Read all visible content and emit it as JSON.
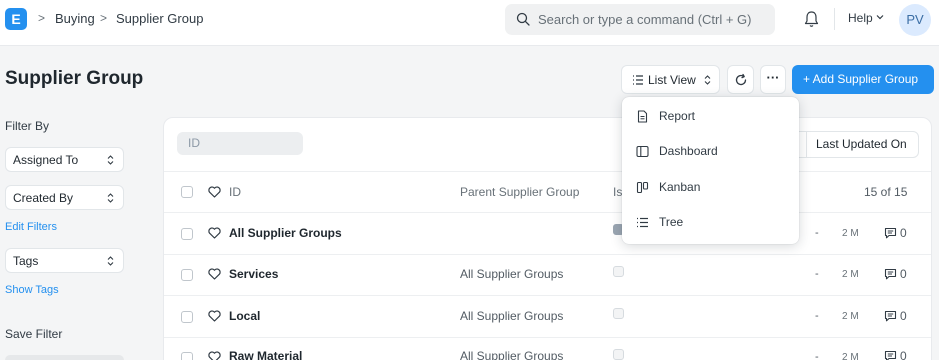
{
  "navbar": {
    "logo_letter": "E",
    "breadcrumbs": [
      "Buying",
      "Supplier Group"
    ],
    "search_placeholder": "Search or type a command (Ctrl + G)",
    "help_label": "Help",
    "avatar_initials": "PV"
  },
  "page": {
    "title": "Supplier Group",
    "list_view_label": "List View",
    "more_label": "···",
    "add_button_label": "+ Add Supplier Group"
  },
  "sidebar": {
    "filter_by_label": "Filter By",
    "assigned_to_label": "Assigned To",
    "created_by_label": "Created By",
    "edit_filters_label": "Edit Filters",
    "tags_label": "Tags",
    "show_tags_label": "Show Tags",
    "save_filter_label": "Save Filter"
  },
  "list": {
    "id_filter_placeholder": "ID",
    "sort_label": "Last Updated On",
    "columns": {
      "id": "ID",
      "parent": "Parent Supplier Group",
      "is_group": "Is"
    },
    "count_label": "15 of 15",
    "rows": [
      {
        "name": "All Supplier Groups",
        "parent": "",
        "is_group": true,
        "dash": "-",
        "time": "2 M",
        "comments": "0"
      },
      {
        "name": "Services",
        "parent": "All Supplier Groups",
        "is_group": false,
        "dash": "-",
        "time": "2 M",
        "comments": "0"
      },
      {
        "name": "Local",
        "parent": "All Supplier Groups",
        "is_group": false,
        "dash": "-",
        "time": "2 M",
        "comments": "0"
      },
      {
        "name": "Raw Material",
        "parent": "All Supplier Groups",
        "is_group": false,
        "dash": "-",
        "time": "2 M",
        "comments": "0"
      }
    ]
  },
  "view_menu": {
    "items": [
      {
        "label": "Report",
        "icon": "report-icon"
      },
      {
        "label": "Dashboard",
        "icon": "dashboard-icon"
      },
      {
        "label": "Kanban",
        "icon": "kanban-icon"
      },
      {
        "label": "Tree",
        "icon": "tree-icon"
      }
    ]
  },
  "colors": {
    "primary": "#2490ef",
    "text": "#1f272e",
    "muted": "#687178",
    "background": "#f4f5f6"
  }
}
